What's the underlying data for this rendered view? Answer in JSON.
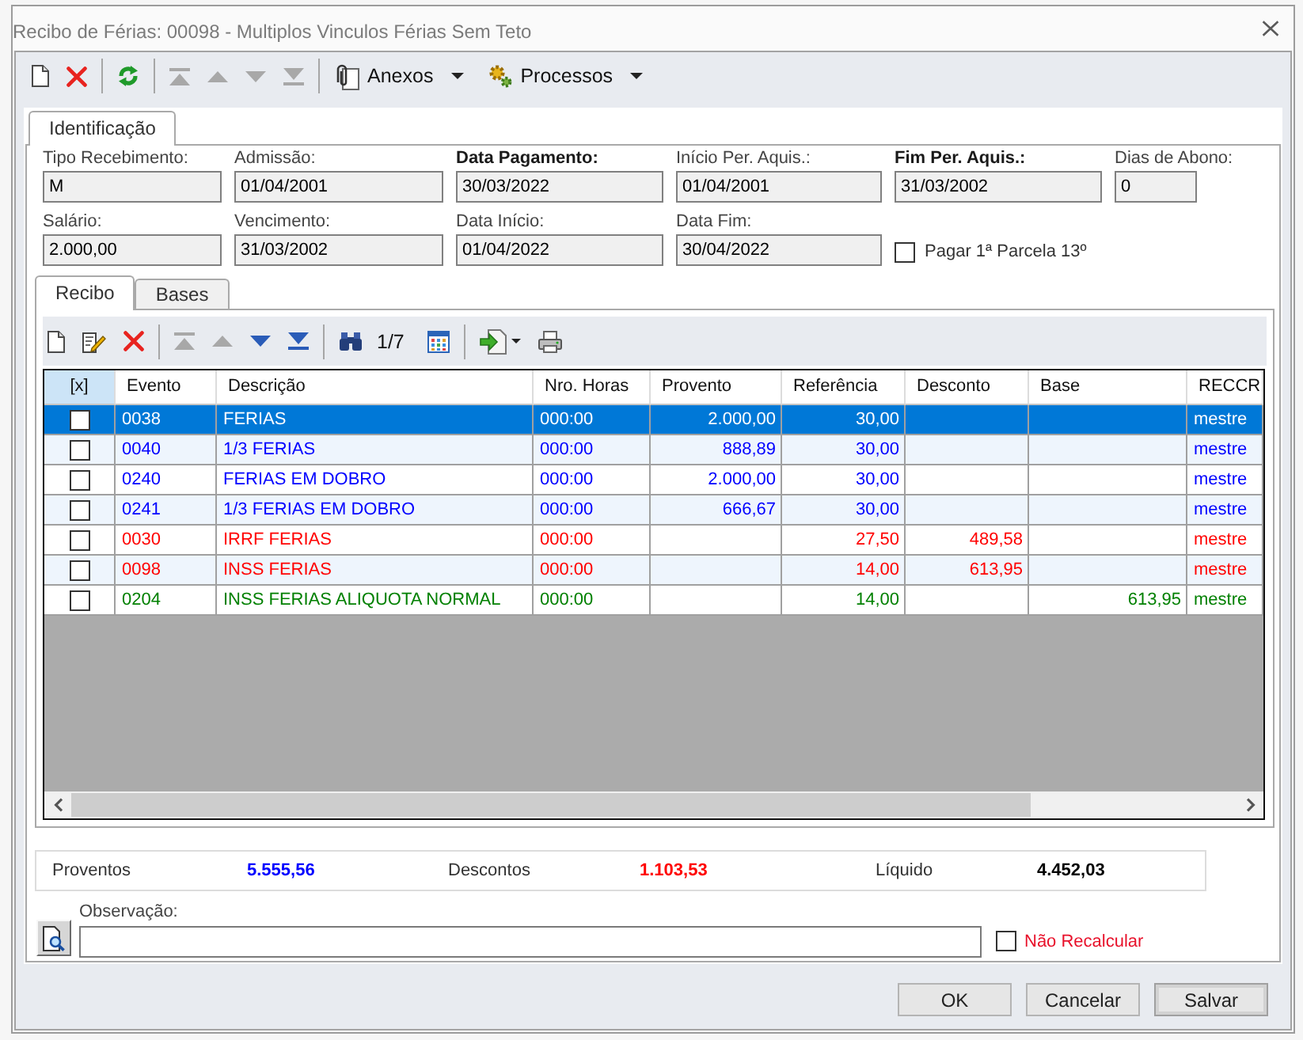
{
  "window": {
    "title": "Recibo de Férias: 00098 - Multiplos Vinculos Férias Sem Teto"
  },
  "toolbar": {
    "nav": [
      {
        "kind": "first",
        "disabled": true
      },
      {
        "kind": "up",
        "disabled": true
      },
      {
        "kind": "down",
        "disabled": true
      },
      {
        "kind": "last",
        "disabled": true
      }
    ],
    "menus": [
      {
        "kind": "attachments",
        "label": "Anexos"
      },
      {
        "kind": "processes",
        "label": "Processos"
      }
    ]
  },
  "tabs": [
    {
      "label": "Identificação",
      "selected": true
    }
  ],
  "form": {
    "fields": [
      {
        "label": "Tipo Recebimento:",
        "value": "M",
        "required": false
      },
      {
        "label": "Admissão:",
        "value": "01/04/2001",
        "required": false
      },
      {
        "label": "Data Pagamento:",
        "value": "30/03/2022",
        "required": true
      },
      {
        "label": "Início Per. Aquis.:",
        "value": "01/04/2001",
        "required": false
      },
      {
        "label": "Fim Per. Aquis.:",
        "value": "31/03/2002",
        "required": true
      },
      {
        "label": "Dias de Abono:",
        "value": "0",
        "required": false
      },
      {
        "label": "Salário:",
        "value": "2.000,00",
        "required": false
      },
      {
        "label": "Vencimento:",
        "value": "31/03/2002",
        "required": false
      },
      {
        "label": "Data Início:",
        "value": "01/04/2022",
        "required": false
      },
      {
        "label": "Data Fim:",
        "value": "30/04/2022",
        "required": false
      }
    ],
    "pay_13th": {
      "label": "Pagar 1ª Parcela 13º",
      "checked": false
    }
  },
  "inner_tabs": [
    {
      "label": "Recibo",
      "selected": true
    },
    {
      "label": "Bases",
      "selected": false
    }
  ],
  "grid_toolbar": {
    "nav": [
      {
        "kind": "first",
        "disabled": true
      },
      {
        "kind": "up",
        "disabled": true
      },
      {
        "kind": "down",
        "disabled": false
      },
      {
        "kind": "last",
        "disabled": false
      }
    ],
    "record_position": "1/7"
  },
  "table": {
    "check_header": "[x]",
    "columns": [
      {
        "label": "Evento",
        "kind": "text"
      },
      {
        "label": "Descrição",
        "kind": "text"
      },
      {
        "label": "Nro. Horas",
        "kind": "text"
      },
      {
        "label": "Provento",
        "kind": "number"
      },
      {
        "label": "Referência",
        "kind": "number"
      },
      {
        "label": "Desconto",
        "kind": "number"
      },
      {
        "label": "Base",
        "kind": "number"
      },
      {
        "label": "RECCR",
        "kind": "text"
      }
    ],
    "rows": [
      {
        "checked": false,
        "selected": true,
        "cells": [
          "0038",
          "FERIAS",
          "000:00",
          "2.000,00",
          "30,00",
          null,
          null,
          "mestre"
        ]
      },
      {
        "checked": false,
        "selected": false,
        "color": "#0000ff",
        "cells": [
          "0040",
          "1/3 FERIAS",
          "000:00",
          "888,89",
          "30,00",
          null,
          null,
          "mestre"
        ]
      },
      {
        "checked": false,
        "selected": false,
        "color": "#0000ff",
        "cells": [
          "0240",
          "FERIAS EM DOBRO",
          "000:00",
          "2.000,00",
          "30,00",
          null,
          null,
          "mestre"
        ]
      },
      {
        "checked": false,
        "selected": false,
        "color": "#0000ff",
        "cells": [
          "0241",
          "1/3 FERIAS EM DOBRO",
          "000:00",
          "666,67",
          "30,00",
          null,
          null,
          "mestre"
        ]
      },
      {
        "checked": false,
        "selected": false,
        "color": "#ff0000",
        "cells": [
          "0030",
          "IRRF FERIAS",
          "000:00",
          null,
          "27,50",
          "489,58",
          null,
          "mestre"
        ]
      },
      {
        "checked": false,
        "selected": false,
        "color": "#ff0000",
        "cells": [
          "0098",
          "INSS FERIAS",
          "000:00",
          null,
          "14,00",
          "613,95",
          null,
          "mestre"
        ]
      },
      {
        "checked": false,
        "selected": false,
        "color": "#008000",
        "cells": [
          "0204",
          "INSS FERIAS ALIQUOTA NORMAL",
          "000:00",
          null,
          "14,00",
          null,
          "613,95",
          "mestre"
        ]
      }
    ]
  },
  "totals": [
    {
      "label": "Proventos",
      "value": "5.555,56",
      "color": "#0000ff"
    },
    {
      "label": "Descontos",
      "value": "1.103,53",
      "color": "#ff0000"
    },
    {
      "label": "Líquido",
      "value": "4.452,03",
      "color": "#000000"
    }
  ],
  "observation": {
    "label": "Observação:"
  },
  "no_recalculate": {
    "label": "Não Recalcular",
    "checked": false
  },
  "buttons": [
    {
      "label": "OK",
      "default": false
    },
    {
      "label": "Cancelar",
      "default": false
    },
    {
      "label": "Salvar",
      "default": true
    }
  ]
}
